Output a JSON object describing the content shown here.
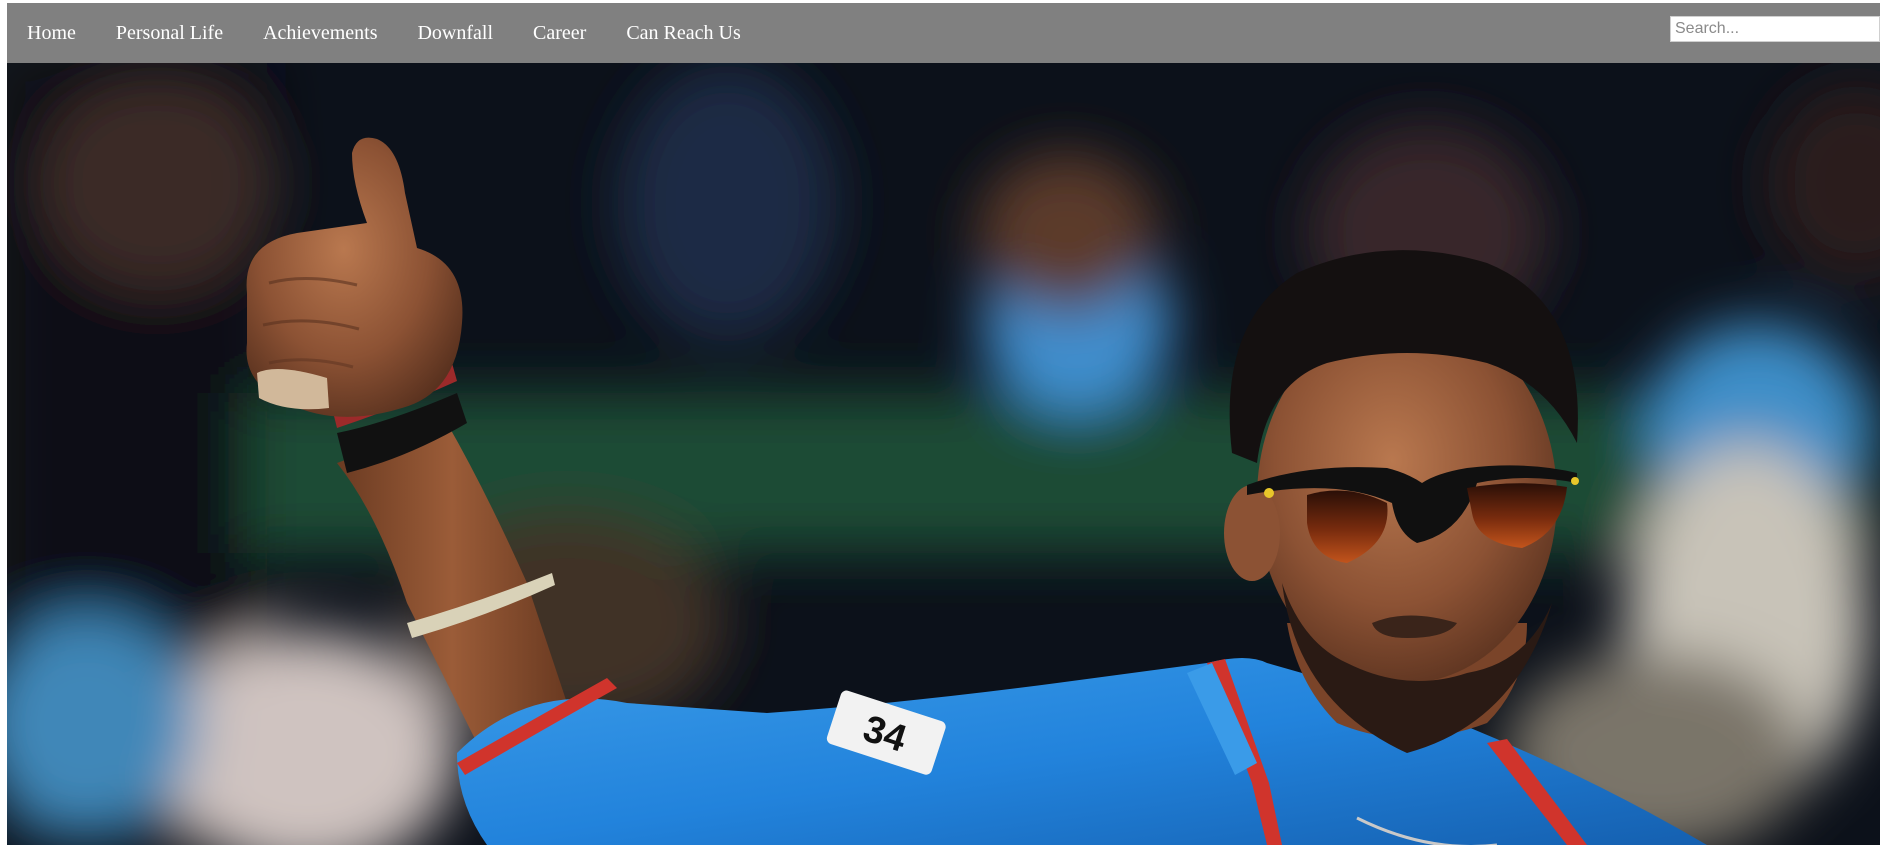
{
  "nav": {
    "links": [
      {
        "label": "Home"
      },
      {
        "label": "Personal Life"
      },
      {
        "label": "Achievements"
      },
      {
        "label": "Downfall"
      },
      {
        "label": "Career"
      },
      {
        "label": "Can Reach Us"
      }
    ],
    "search": {
      "placeholder": "Search...",
      "value": ""
    }
  },
  "hero": {
    "jersey_number": "34"
  },
  "colors": {
    "nav_background": "#808080",
    "nav_text": "#ffffff",
    "jersey_blue": "#2a86d8",
    "jersey_trim": "#d0342c"
  }
}
